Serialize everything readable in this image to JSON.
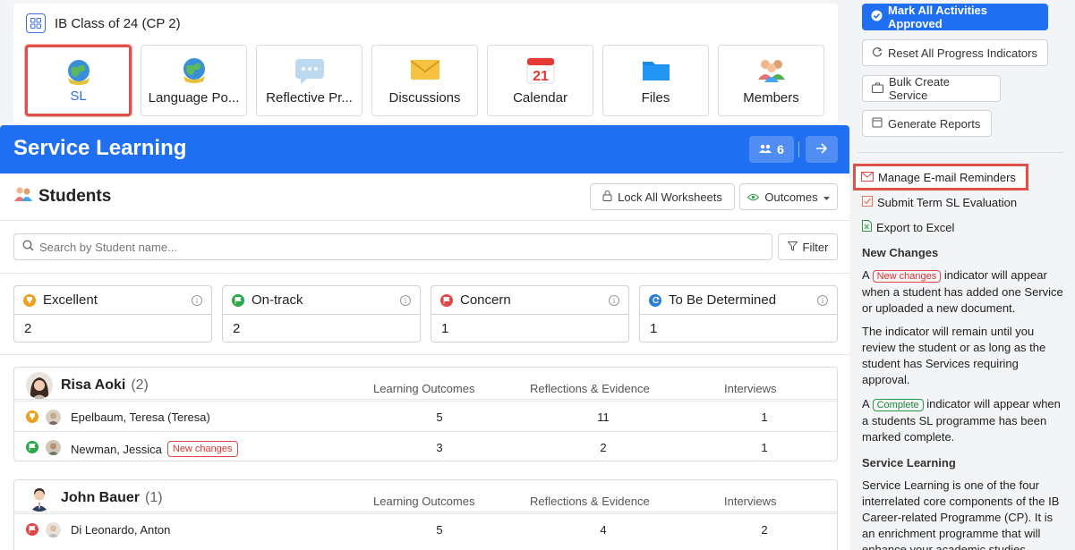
{
  "class_header": {
    "title": "IB Class of 24 (CP 2)",
    "tiles": [
      {
        "label": "SL",
        "icon": "globe-icon",
        "active": true
      },
      {
        "label": "Language Po...",
        "icon": "globe-icon",
        "active": false
      },
      {
        "label": "Reflective Pr...",
        "icon": "chat-bubble-icon",
        "active": false
      },
      {
        "label": "Discussions",
        "icon": "envelope-icon",
        "active": false
      },
      {
        "label": "Calendar",
        "icon": "calendar-icon",
        "active": false,
        "day": "21"
      },
      {
        "label": "Files",
        "icon": "folder-icon",
        "active": false
      },
      {
        "label": "Members",
        "icon": "people-icon",
        "active": false
      }
    ]
  },
  "banner": {
    "title": "Service Learning",
    "members_count": "6",
    "color": "#1f6ff0"
  },
  "students_panel": {
    "heading": "Students",
    "lock_button": "Lock All Worksheets",
    "outcomes_button": "Outcomes",
    "search_placeholder": "Search by Student name...",
    "filter_button": "Filter",
    "status_cards": [
      {
        "label": "Excellent",
        "value": "2",
        "color": "#f0a020"
      },
      {
        "label": "On-track",
        "value": "2",
        "color": "#2aa84a"
      },
      {
        "label": "Concern",
        "value": "1",
        "color": "#e04848"
      },
      {
        "label": "To Be Determined",
        "value": "1",
        "color": "#2b7fd9"
      }
    ],
    "columns": [
      "Learning Outcomes",
      "Reflections & Evidence",
      "Interviews"
    ],
    "groups": [
      {
        "advisor": "Risa Aoki",
        "count": "(2)",
        "rows": [
          {
            "name": "Epelbaum, Teresa (Teresa)",
            "status": "excellent",
            "badge": "",
            "outcomes": "5",
            "reflections": "11",
            "interviews": "1"
          },
          {
            "name": "Newman, Jessica",
            "status": "on-track",
            "badge": "New changes",
            "outcomes": "3",
            "reflections": "2",
            "interviews": "1"
          }
        ]
      },
      {
        "advisor": "John Bauer",
        "count": "(1)",
        "rows": [
          {
            "name": "Di Leonardo, Anton",
            "status": "concern",
            "badge": "",
            "outcomes": "5",
            "reflections": "4",
            "interviews": "2"
          }
        ]
      }
    ]
  },
  "sidebar": {
    "mark_approved": "Mark All Activities Approved",
    "reset_progress": "Reset All Progress Indicators",
    "bulk_create": "Bulk Create Service",
    "generate_reports": "Generate Reports",
    "manage_reminders": "Manage E-mail Reminders",
    "submit_evaluation": "Submit Term SL Evaluation",
    "export_excel": "Export to Excel",
    "new_changes_heading": "New Changes",
    "nc_text_a": "A",
    "nc_pill": "New changes",
    "nc_text_b": "indicator will appear when a student has added one Service or uploaded a new document.",
    "nc_text_2": "The indicator will remain until you review the student or as long as the student has Services requiring approval.",
    "cp_text_a": "A",
    "cp_pill": "Complete",
    "cp_text_b": "indicator will appear when a students SL programme has been marked complete.",
    "sl_heading": "Service Learning",
    "sl_text": "Service Learning is one of the four interrelated core components of the IB Career-related Programme (CP). It is an enrichment programme that will enhance your academic studies"
  }
}
